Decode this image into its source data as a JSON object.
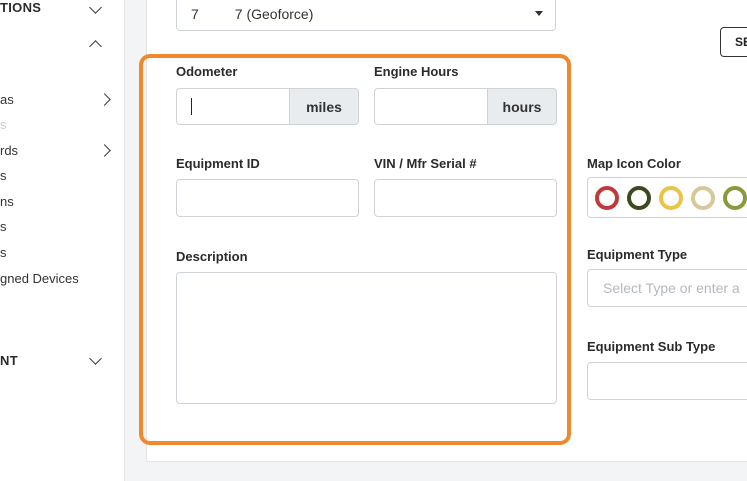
{
  "sidebar": {
    "sections": [
      {
        "label": "TIONS"
      },
      {
        "label": "NT"
      }
    ],
    "items": [
      {
        "label": "as"
      },
      {
        "label": "s"
      },
      {
        "label": "rds"
      },
      {
        "label": "s"
      },
      {
        "label": "ns"
      },
      {
        "label": "s"
      },
      {
        "label": "s"
      },
      {
        "label": "gned Devices"
      }
    ]
  },
  "header": {
    "equipment_select_value": "7",
    "equipment_select_suffix": "7 (Geoforce)",
    "se_button_label": "SE"
  },
  "form": {
    "odometer": {
      "label": "Odometer",
      "unit": "miles",
      "value": ""
    },
    "engine_hours": {
      "label": "Engine Hours",
      "unit": "hours",
      "value": ""
    },
    "equipment_id": {
      "label": "Equipment ID",
      "value": ""
    },
    "vin": {
      "label": "VIN / Mfr Serial #",
      "value": ""
    },
    "description": {
      "label": "Description",
      "value": ""
    }
  },
  "right_panel": {
    "map_icon_color": {
      "label": "Map Icon Color",
      "colors": [
        "#c0393b",
        "#3d4a1f",
        "#e9c446",
        "#d7c89a",
        "#8a9a3a"
      ]
    },
    "equipment_type": {
      "label": "Equipment Type",
      "placeholder": "Select Type or enter a"
    },
    "equipment_sub_type": {
      "label": "Equipment Sub Type",
      "value": ""
    }
  },
  "colors": {
    "highlight": "#f0892e"
  }
}
